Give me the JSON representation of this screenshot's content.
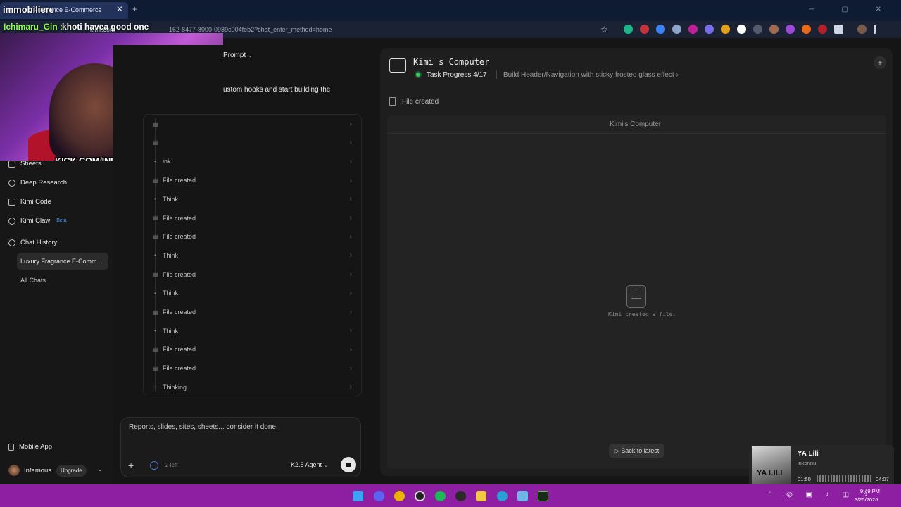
{
  "browser": {
    "tab_title": "Fragrance E-Commerce",
    "url_host": "kimi.com",
    "url_rest": "162-8477-8000-0989c004feb2?chat_enter_method=home"
  },
  "stream": {
    "overlay_title": "immobiliere",
    "chat_user": "Ichimaru_Gin :",
    "chat_message": "khoti havea good one",
    "channel": "KICK.COM/INFAMOUSS"
  },
  "sidebar": {
    "items": [
      {
        "label": "Sheets"
      },
      {
        "label": "Deep Research"
      },
      {
        "label": "Kimi Code"
      },
      {
        "label": "Kimi Claw",
        "badge": "Beta"
      }
    ],
    "history_label": "Chat History",
    "active_chat": "Luxury Fragrance E-Comm...",
    "all_chats": "All Chats",
    "mobile_app": "Mobile App",
    "user_name": "Infamous",
    "upgrade": "Upgrade"
  },
  "middle": {
    "prompt_label": "Prompt",
    "intro_text": "ustom hooks and start building the",
    "steps": [
      {
        "label": "",
        "kind": "file"
      },
      {
        "label": "",
        "kind": "file"
      },
      {
        "label": "ink",
        "kind": "dot"
      },
      {
        "label": "File created",
        "kind": "file"
      },
      {
        "label": "Think",
        "kind": "dot"
      },
      {
        "label": "File created",
        "kind": "file"
      },
      {
        "label": "File created",
        "kind": "file"
      },
      {
        "label": "Think",
        "kind": "dot"
      },
      {
        "label": "File created",
        "kind": "file"
      },
      {
        "label": "Think",
        "kind": "dot"
      },
      {
        "label": "File created",
        "kind": "file"
      },
      {
        "label": "Think",
        "kind": "dot"
      },
      {
        "label": "File created",
        "kind": "file"
      },
      {
        "label": "File created",
        "kind": "file"
      },
      {
        "label": "Thinking",
        "kind": "bulb"
      }
    ],
    "composer_placeholder": "Reports, slides, sites, sheets... consider it done.",
    "credits_left": "2 left",
    "agent": "K2.5 Agent"
  },
  "computer": {
    "title": "Kimi's Computer",
    "progress": "Task Progress 4/17",
    "task": "Build Header/Navigation with sticky frosted glass effect",
    "file_label": "File created",
    "viewer_title": "Kimi's Computer",
    "empty_caption": "Kimi created a file.",
    "back_button": "Back to latest"
  },
  "music": {
    "cover_text": "YA LILI",
    "song": "YA Lili",
    "artist": "inkonnu",
    "time_current": "01:50",
    "time_total": "04:07",
    "progress": 0.44
  },
  "taskbar": {
    "time": "9:49 PM",
    "date": "3/25/2026"
  },
  "colors": {
    "accent_blue": "#4f9cff",
    "status_green": "#34c759",
    "taskbar": "#8e1fa3"
  }
}
